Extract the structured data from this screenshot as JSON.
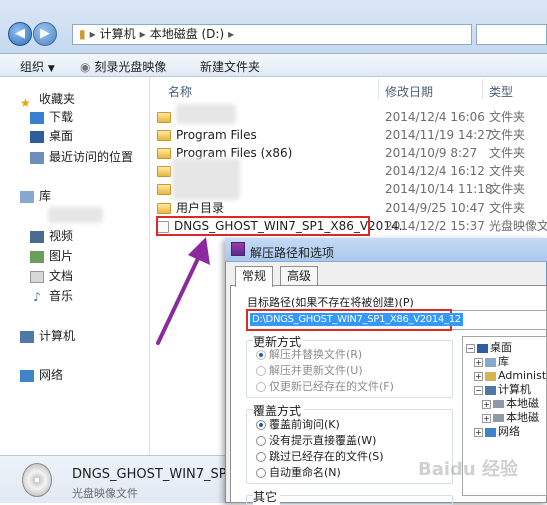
{
  "address": {
    "crumbs": [
      "计算机",
      "本地磁盘 (D:)"
    ]
  },
  "toolbar": {
    "organize": "组织",
    "burn": "刻录光盘映像",
    "new_folder": "新建文件夹"
  },
  "nav": {
    "favorites": "收藏夹",
    "downloads": "下载",
    "desktop": "桌面",
    "recent": "最近访问的位置",
    "libraries": "库",
    "videos": "视频",
    "pictures": "图片",
    "documents": "文档",
    "music": "音乐",
    "computer": "计算机",
    "network": "网络"
  },
  "columns": {
    "name": "名称",
    "date": "修改日期",
    "type": "类型"
  },
  "files": [
    {
      "name": "",
      "date": "2014/12/4 16:06",
      "type": "文件夹"
    },
    {
      "name": "Program Files",
      "date": "2014/11/19 14:27",
      "type": "文件夹"
    },
    {
      "name": "Program Files (x86)",
      "date": "2014/10/9 8:27",
      "type": "文件夹"
    },
    {
      "name": "",
      "date": "2014/12/4 16:12",
      "type": "文件夹"
    },
    {
      "name": "",
      "date": "2014/10/14 11:18",
      "type": "文件夹"
    },
    {
      "name": "用户目录",
      "date": "2014/9/25 10:47",
      "type": "文件夹"
    },
    {
      "name": "DNGS_GHOST_WIN7_SP1_X86_V2014..",
      "date": "2014/12/2 15:37",
      "type": "光盘映像文件"
    }
  ],
  "details": {
    "filename": "DNGS_GHOST_WIN7_SP1_X",
    "filetype": "光盘映像文件"
  },
  "dialog": {
    "title": "解压路径和选项",
    "tabs": [
      "常规",
      "高级"
    ],
    "target_label": "目标路径(如果不存在将被创建)(P)",
    "target_value": "D:\\DNGS_GHOST_WIN7_SP1_X86_V2014_12",
    "update_group": "更新方式",
    "update_options": [
      "解压并替换文件(R)",
      "解压并更新文件(U)",
      "仅更新已经存在的文件(F)"
    ],
    "overwrite_group": "覆盖方式",
    "overwrite_options": [
      "覆盖前询问(K)",
      "没有提示直接覆盖(W)",
      "跳过已经存在的文件(S)",
      "自动重命名(N)"
    ],
    "other_group": "其它",
    "tree": [
      "桌面",
      "库",
      "Administr",
      "计算机",
      "本地磁",
      "本地磁",
      "网络"
    ]
  },
  "watermark": "Baidu 经验"
}
